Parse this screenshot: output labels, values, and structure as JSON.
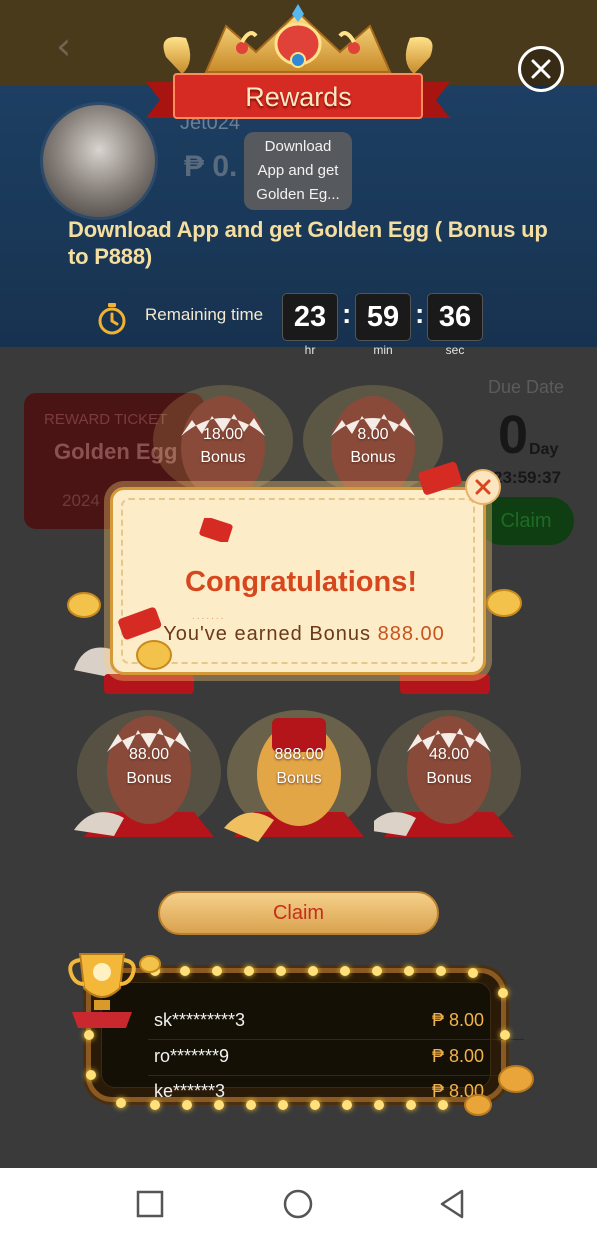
{
  "header": {
    "title": "Rewards"
  },
  "background": {
    "username": "Jet024",
    "balance": "₱ 0.",
    "ticket": {
      "label": "REWARD TICKET",
      "title": "Golden Egg",
      "year": "2024"
    },
    "due": {
      "label": "Due Date",
      "days": "0",
      "day_unit": "Day",
      "countdown": "23:59:37",
      "claim_label": "Claim"
    }
  },
  "tooltip": {
    "line1": "Download",
    "line2": "App and get",
    "line3": "Golden Eg..."
  },
  "promo": {
    "title": "Download App and get Golden Egg ( Bonus up to P888)"
  },
  "timer": {
    "label": "Remaining time",
    "hours": "23",
    "minutes": "59",
    "seconds": "36",
    "hours_unit": "hr",
    "minutes_unit": "min",
    "seconds_unit": "sec",
    "colon": ":"
  },
  "eggs": [
    {
      "value": "18.00",
      "label": "Bonus"
    },
    {
      "value": "8.00",
      "label": "Bonus"
    },
    {
      "value": "88.00",
      "label": "Bonus"
    },
    {
      "value": "888.00",
      "label": "Bonus"
    },
    {
      "value": "48.00",
      "label": "Bonus"
    }
  ],
  "modal": {
    "title": "Congratulations!",
    "message_prefix": "You've earned Bonus ",
    "amount": "888.00"
  },
  "claim_button": {
    "label": "Claim"
  },
  "winners": [
    {
      "name": "sk*********3",
      "amount": "₱ 8.00"
    },
    {
      "name": "ro*******9",
      "amount": "₱ 8.00"
    },
    {
      "name": "ke******3",
      "amount": "₱ 8.00"
    }
  ],
  "colors": {
    "accent": "#d6471d",
    "gold": "#f2b24a",
    "banner_red": "#d62b22"
  },
  "icons": [
    "back-arrow-icon",
    "crown-icon",
    "close-icon",
    "stopwatch-icon",
    "trophy-icon",
    "coin-icon",
    "red-envelope-icon",
    "nav-square-icon",
    "nav-circle-icon",
    "nav-back-triangle-icon"
  ]
}
